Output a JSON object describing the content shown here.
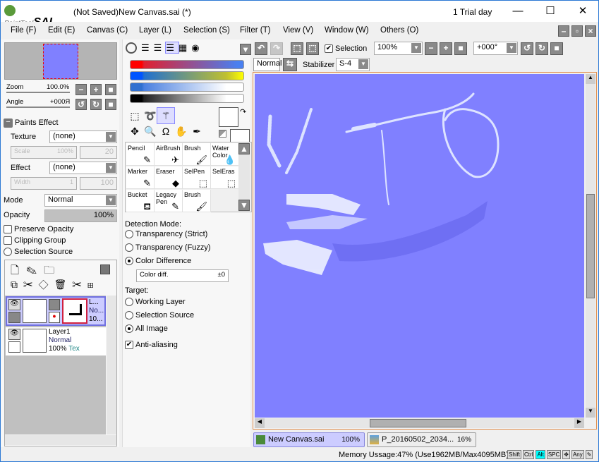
{
  "titlebar": {
    "logo_text": "PaintTool SAI",
    "title": "(Not Saved)New Canvas.sai (*)",
    "trial": "1 Trial day",
    "minimize": "—",
    "maximize": "☐",
    "close": "✕"
  },
  "menu": [
    "File (F)",
    "Edit (E)",
    "Canvas (C)",
    "Layer (L)",
    "Selection (S)",
    "Filter (T)",
    "View (V)",
    "Window (W)",
    "Others (O)"
  ],
  "navigator": {
    "zoom_label": "Zoom",
    "zoom_value": "100.0%",
    "angle_label": "Angle",
    "angle_value": "+000Я"
  },
  "paints_effect": {
    "title": "Paints Effect",
    "texture_label": "Texture",
    "texture_value": "(none)",
    "scale_label": "Scale",
    "scale_value": "100%",
    "scale_num": "20",
    "effect_label": "Effect",
    "effect_value": "(none)",
    "width_label": "Width",
    "width_value": "1",
    "width_num": "100"
  },
  "layer_props": {
    "mode_label": "Mode",
    "mode_value": "Normal",
    "opacity_label": "Opacity",
    "opacity_value": "100%",
    "opacity_fraction": 1.0,
    "preserve_opacity": "Preserve Opacity",
    "clipping_group": "Clipping Group",
    "selection_source": "Selection Source"
  },
  "layers": [
    {
      "name": "L...",
      "mode": "No...",
      "opacity": "10...",
      "selected": true
    },
    {
      "name": "Layer1",
      "mode": "Normal",
      "opacity": "100%",
      "extra": "Tex",
      "selected": false
    }
  ],
  "brushes": [
    {
      "name": "Pencil",
      "icon": "pencil-icon",
      "glyph": "✎"
    },
    {
      "name": "AirBrush",
      "icon": "airbrush-icon",
      "glyph": "✈"
    },
    {
      "name": "Brush",
      "icon": "brush-icon",
      "glyph": "🖌"
    },
    {
      "name": "Water Color",
      "icon": "watercolor-icon",
      "glyph": "💧"
    },
    {
      "name": "Marker",
      "icon": "marker-icon",
      "glyph": "✎"
    },
    {
      "name": "Eraser",
      "icon": "eraser-icon",
      "glyph": "◆"
    },
    {
      "name": "SelPen",
      "icon": "selpen-icon",
      "glyph": "⬚"
    },
    {
      "name": "SelEras",
      "icon": "seleras-icon",
      "glyph": "⬚"
    },
    {
      "name": "Bucket",
      "icon": "bucket-icon",
      "glyph": "⛾"
    },
    {
      "name": "Legacy Pen",
      "icon": "legacy-pen-icon",
      "glyph": "✎"
    },
    {
      "name": "Brush",
      "icon": "brush-icon",
      "glyph": "🖌"
    }
  ],
  "tool_options": {
    "detection_title": "Detection Mode:",
    "detection": [
      "Transparency (Strict)",
      "Transparency (Fuzzy)",
      "Color Difference"
    ],
    "detection_selected": 2,
    "color_diff_label": "Color diff.",
    "color_diff_value": "±0",
    "target_title": "Target:",
    "target": [
      "Working Layer",
      "Selection Source",
      "All Image"
    ],
    "target_selected": 2,
    "anti_aliasing": "Anti-aliasing",
    "anti_aliasing_checked": true
  },
  "toolbar": {
    "selection_label": "Selection",
    "selection_checked": true,
    "zoom": "100%",
    "angle": "+000°",
    "mode": "Normal",
    "stabilizer_label": "Stabilizer",
    "stabilizer": "S-4"
  },
  "canvas": {
    "background": "#8080ff"
  },
  "tabs": [
    {
      "name": "New Canvas.sai",
      "zoom": "100%",
      "active": true
    },
    {
      "name": "P_20160502_2034...",
      "zoom": "16%",
      "active": false
    }
  ],
  "status": {
    "memory": "Memory Ussage:47% (Use1962MB/Max4095MB)",
    "keys": [
      "Shift",
      "Ctrl",
      "Alt",
      "SPC",
      "✥",
      "Any",
      "✎"
    ],
    "active_key": "Alt"
  }
}
